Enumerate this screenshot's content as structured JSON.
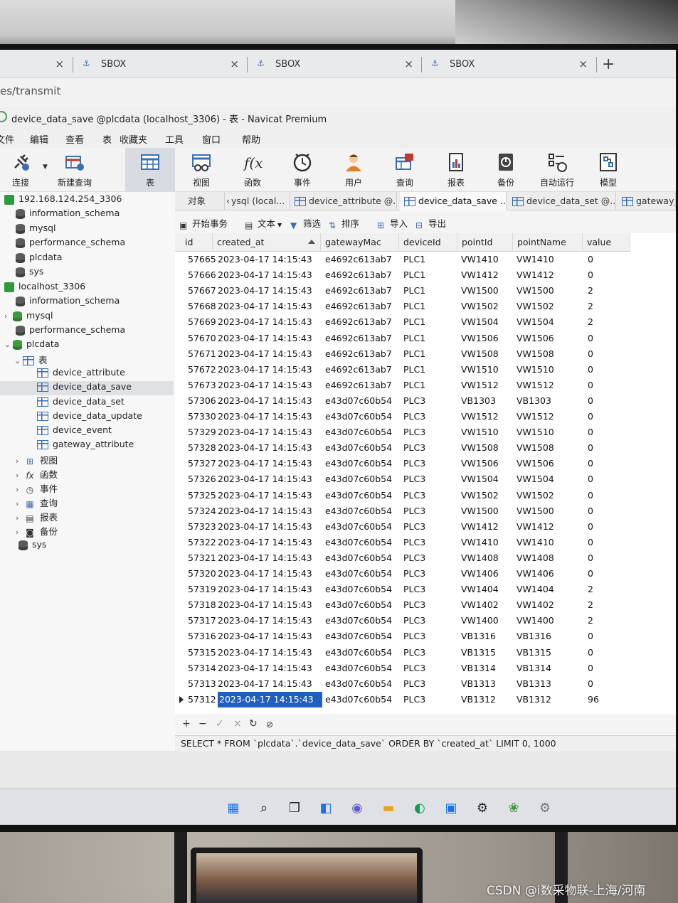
{
  "sbox_tabs": [
    {
      "label": "SBOX"
    },
    {
      "label": "SBOX"
    },
    {
      "label": "SBOX"
    }
  ],
  "path": "es/transmit",
  "window_title": "device_data_save @plcdata (localhost_3306) - 表 - Navicat Premium",
  "menu": [
    "文件",
    "编辑",
    "查看",
    "表",
    "收藏夹",
    "工具",
    "窗口",
    "帮助"
  ],
  "toolbar": [
    {
      "label": "连接",
      "icon": "plug-icon"
    },
    {
      "label": "新建查询",
      "icon": "new-query-icon"
    },
    {
      "label": "表",
      "icon": "table-icon"
    },
    {
      "label": "视图",
      "icon": "view-icon"
    },
    {
      "label": "函数",
      "icon": "function-icon"
    },
    {
      "label": "事件",
      "icon": "clock-icon"
    },
    {
      "label": "用户",
      "icon": "user-icon"
    },
    {
      "label": "查询",
      "icon": "query-icon"
    },
    {
      "label": "报表",
      "icon": "report-icon"
    },
    {
      "label": "备份",
      "icon": "backup-icon"
    },
    {
      "label": "自动运行",
      "icon": "autorun-icon"
    },
    {
      "label": "模型",
      "icon": "model-icon"
    }
  ],
  "sidebar": {
    "conn1": "192.168.124.254_3306",
    "conn1_dbs": [
      "information_schema",
      "mysql",
      "performance_schema",
      "plcdata",
      "sys"
    ],
    "conn2": "localhost_3306",
    "conn2_dbs_before": [
      "information_schema",
      "mysql",
      "performance_schema"
    ],
    "open_db": "plcdata",
    "tables_folder": "表",
    "tables": [
      "device_attribute",
      "device_data_save",
      "device_data_set",
      "device_data_update",
      "device_event",
      "gateway_attribute"
    ],
    "folders": [
      "视图",
      "函数",
      "事件",
      "查询",
      "报表",
      "备份"
    ],
    "last_db": "sys"
  },
  "object_tabs": [
    "对象",
    "ysql (local...",
    "device_attribute @...",
    "device_data_save ...",
    "device_data_set @...",
    "gateway_a"
  ],
  "data_toolbar": [
    "开始事务",
    "文本",
    "筛选",
    "排序",
    "导入",
    "导出"
  ],
  "columns": [
    "id",
    "created_at",
    "gatewayMac",
    "deviceId",
    "pointId",
    "pointName",
    "value"
  ],
  "rows": [
    [
      "57665",
      "2023-04-17 14:15:43",
      "e4692c613ab7",
      "PLC1",
      "VW1410",
      "VW1410",
      "0"
    ],
    [
      "57666",
      "2023-04-17 14:15:43",
      "e4692c613ab7",
      "PLC1",
      "VW1412",
      "VW1412",
      "0"
    ],
    [
      "57667",
      "2023-04-17 14:15:43",
      "e4692c613ab7",
      "PLC1",
      "VW1500",
      "VW1500",
      "2"
    ],
    [
      "57668",
      "2023-04-17 14:15:43",
      "e4692c613ab7",
      "PLC1",
      "VW1502",
      "VW1502",
      "2"
    ],
    [
      "57669",
      "2023-04-17 14:15:43",
      "e4692c613ab7",
      "PLC1",
      "VW1504",
      "VW1504",
      "2"
    ],
    [
      "57670",
      "2023-04-17 14:15:43",
      "e4692c613ab7",
      "PLC1",
      "VW1506",
      "VW1506",
      "0"
    ],
    [
      "57671",
      "2023-04-17 14:15:43",
      "e4692c613ab7",
      "PLC1",
      "VW1508",
      "VW1508",
      "0"
    ],
    [
      "57672",
      "2023-04-17 14:15:43",
      "e4692c613ab7",
      "PLC1",
      "VW1510",
      "VW1510",
      "0"
    ],
    [
      "57673",
      "2023-04-17 14:15:43",
      "e4692c613ab7",
      "PLC1",
      "VW1512",
      "VW1512",
      "0"
    ],
    [
      "57306",
      "2023-04-17 14:15:43",
      "e43d07c60b54",
      "PLC3",
      "VB1303",
      "VB1303",
      "0"
    ],
    [
      "57330",
      "2023-04-17 14:15:43",
      "e43d07c60b54",
      "PLC3",
      "VW1512",
      "VW1512",
      "0"
    ],
    [
      "57329",
      "2023-04-17 14:15:43",
      "e43d07c60b54",
      "PLC3",
      "VW1510",
      "VW1510",
      "0"
    ],
    [
      "57328",
      "2023-04-17 14:15:43",
      "e43d07c60b54",
      "PLC3",
      "VW1508",
      "VW1508",
      "0"
    ],
    [
      "57327",
      "2023-04-17 14:15:43",
      "e43d07c60b54",
      "PLC3",
      "VW1506",
      "VW1506",
      "0"
    ],
    [
      "57326",
      "2023-04-17 14:15:43",
      "e43d07c60b54",
      "PLC3",
      "VW1504",
      "VW1504",
      "0"
    ],
    [
      "57325",
      "2023-04-17 14:15:43",
      "e43d07c60b54",
      "PLC3",
      "VW1502",
      "VW1502",
      "0"
    ],
    [
      "57324",
      "2023-04-17 14:15:43",
      "e43d07c60b54",
      "PLC3",
      "VW1500",
      "VW1500",
      "0"
    ],
    [
      "57323",
      "2023-04-17 14:15:43",
      "e43d07c60b54",
      "PLC3",
      "VW1412",
      "VW1412",
      "0"
    ],
    [
      "57322",
      "2023-04-17 14:15:43",
      "e43d07c60b54",
      "PLC3",
      "VW1410",
      "VW1410",
      "0"
    ],
    [
      "57321",
      "2023-04-17 14:15:43",
      "e43d07c60b54",
      "PLC3",
      "VW1408",
      "VW1408",
      "0"
    ],
    [
      "57320",
      "2023-04-17 14:15:43",
      "e43d07c60b54",
      "PLC3",
      "VW1406",
      "VW1406",
      "0"
    ],
    [
      "57319",
      "2023-04-17 14:15:43",
      "e43d07c60b54",
      "PLC3",
      "VW1404",
      "VW1404",
      "2"
    ],
    [
      "57318",
      "2023-04-17 14:15:43",
      "e43d07c60b54",
      "PLC3",
      "VW1402",
      "VW1402",
      "2"
    ],
    [
      "57317",
      "2023-04-17 14:15:43",
      "e43d07c60b54",
      "PLC3",
      "VW1400",
      "VW1400",
      "2"
    ],
    [
      "57316",
      "2023-04-17 14:15:43",
      "e43d07c60b54",
      "PLC3",
      "VB1316",
      "VB1316",
      "0"
    ],
    [
      "57315",
      "2023-04-17 14:15:43",
      "e43d07c60b54",
      "PLC3",
      "VB1315",
      "VB1315",
      "0"
    ],
    [
      "57314",
      "2023-04-17 14:15:43",
      "e43d07c60b54",
      "PLC3",
      "VB1314",
      "VB1314",
      "0"
    ],
    [
      "57313",
      "2023-04-17 14:15:43",
      "e43d07c60b54",
      "PLC3",
      "VB1313",
      "VB1313",
      "0"
    ],
    [
      "57312",
      "2023-04-17 14:15:43",
      "e43d07c60b54",
      "PLC3",
      "VB1312",
      "VB1312",
      "96"
    ]
  ],
  "selected_row_index": 28,
  "sql": "SELECT * FROM `plcdata`.`device_data_save` ORDER BY `created_at` LIMIT 0, 1000",
  "watermark": "CSDN @i数采物联-上海/河南",
  "colors": {
    "selection": "#1f5fbf",
    "accent": "#3a6fb5"
  }
}
